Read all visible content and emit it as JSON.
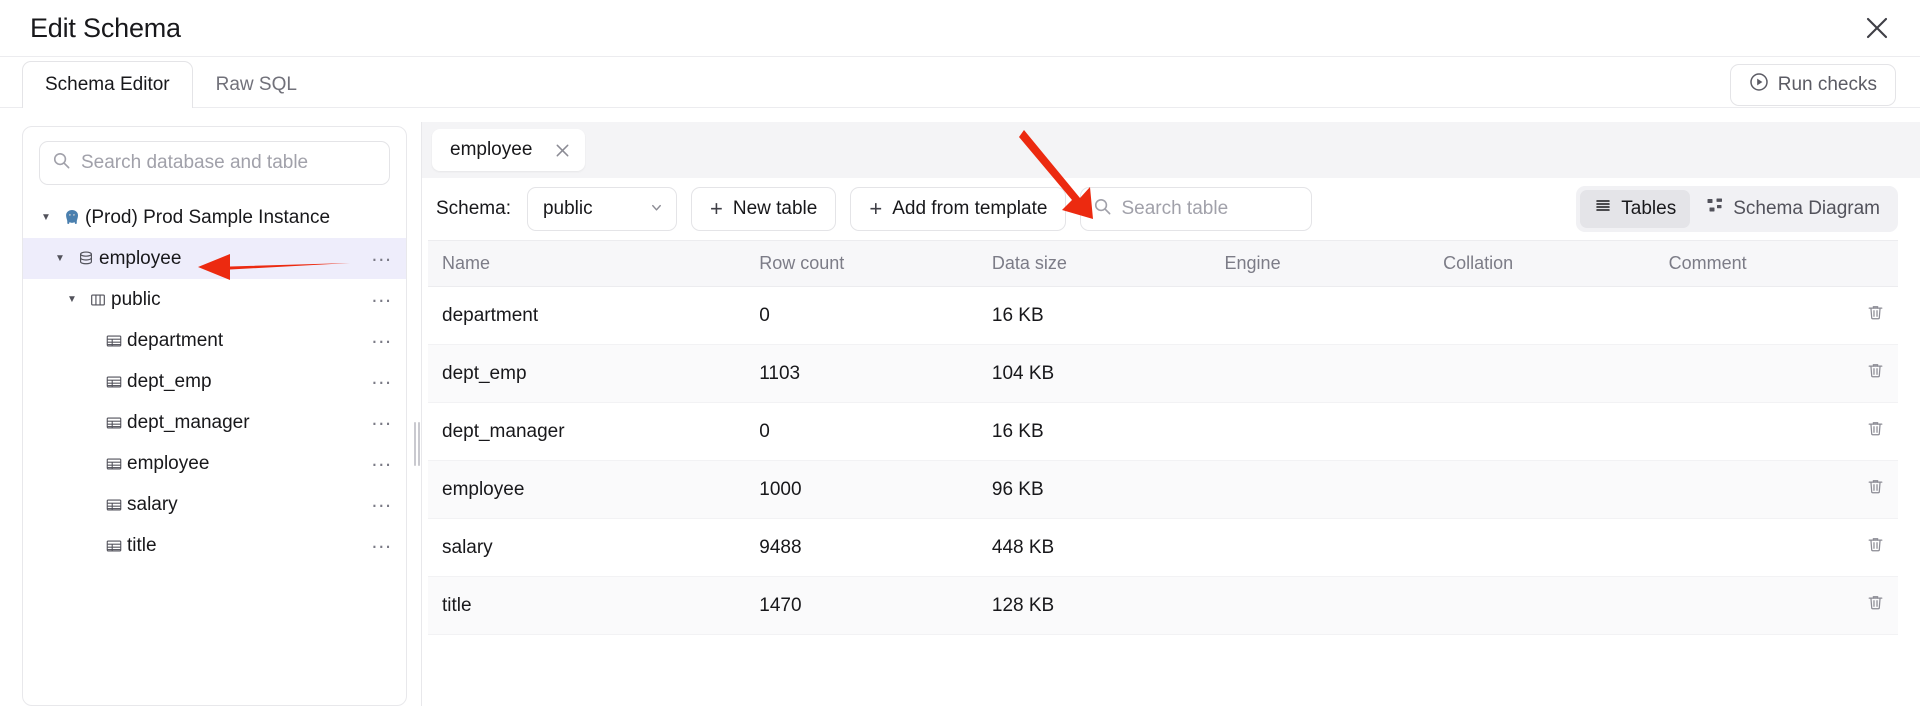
{
  "header": {
    "title": "Edit Schema",
    "close_icon": "close-icon"
  },
  "tabs": {
    "items": [
      {
        "label": "Schema Editor",
        "active": true
      },
      {
        "label": "Raw SQL",
        "active": false
      }
    ],
    "run_checks": {
      "label": "Run checks",
      "icon": "play-circle-icon"
    }
  },
  "sidebar": {
    "search": {
      "placeholder": "Search database and table",
      "value": "",
      "icon": "search-icon"
    },
    "tree": [
      {
        "label": "(Prod) Prod Sample Instance",
        "icon": "postgres-elephant-icon",
        "indent": 1,
        "caret": "down",
        "selected": false,
        "menu": false
      },
      {
        "label": "employee",
        "icon": "database-icon",
        "indent": 1,
        "caret": "down",
        "selected": true,
        "menu": true
      },
      {
        "label": "public",
        "icon": "schema-icon",
        "indent": 2,
        "caret": "down",
        "selected": false,
        "menu": true
      },
      {
        "label": "department",
        "icon": "table-icon",
        "indent": 3,
        "caret": "none",
        "selected": false,
        "menu": true
      },
      {
        "label": "dept_emp",
        "icon": "table-icon",
        "indent": 3,
        "caret": "none",
        "selected": false,
        "menu": true
      },
      {
        "label": "dept_manager",
        "icon": "table-icon",
        "indent": 3,
        "caret": "none",
        "selected": false,
        "menu": true
      },
      {
        "label": "employee",
        "icon": "table-icon",
        "indent": 3,
        "caret": "none",
        "selected": false,
        "menu": true
      },
      {
        "label": "salary",
        "icon": "table-icon",
        "indent": 3,
        "caret": "none",
        "selected": false,
        "menu": true
      },
      {
        "label": "title",
        "icon": "table-icon",
        "indent": 3,
        "caret": "none",
        "selected": false,
        "menu": true
      }
    ],
    "menu_dots": "..."
  },
  "main": {
    "chip": {
      "label": "employee",
      "close_icon": "close-icon"
    },
    "toolbar": {
      "schema_label": "Schema:",
      "schema_value": "public",
      "new_table_label": "New table",
      "add_from_template_label": "Add from template",
      "search_placeholder": "Search table",
      "search_value": "",
      "view_tables_label": "Tables",
      "view_diagram_label": "Schema Diagram"
    },
    "table": {
      "columns": [
        "Name",
        "Row count",
        "Data size",
        "Engine",
        "Collation",
        "Comment"
      ],
      "rows": [
        {
          "name": "department",
          "row_count": "0",
          "data_size": "16 KB",
          "engine": "",
          "collation": "",
          "comment": ""
        },
        {
          "name": "dept_emp",
          "row_count": "1103",
          "data_size": "104 KB",
          "engine": "",
          "collation": "",
          "comment": ""
        },
        {
          "name": "dept_manager",
          "row_count": "0",
          "data_size": "16 KB",
          "engine": "",
          "collation": "",
          "comment": ""
        },
        {
          "name": "employee",
          "row_count": "1000",
          "data_size": "96 KB",
          "engine": "",
          "collation": "",
          "comment": ""
        },
        {
          "name": "salary",
          "row_count": "9488",
          "data_size": "448 KB",
          "engine": "",
          "collation": "",
          "comment": ""
        },
        {
          "name": "title",
          "row_count": "1470",
          "data_size": "128 KB",
          "engine": "",
          "collation": "",
          "comment": ""
        }
      ],
      "delete_icon": "trash-icon"
    }
  },
  "annotations": {
    "color": "#ec2a10",
    "arrows": [
      {
        "name": "arrow-pointing-employee-database",
        "direction": "left"
      },
      {
        "name": "arrow-pointing-add-from-template",
        "direction": "down-right"
      }
    ]
  }
}
